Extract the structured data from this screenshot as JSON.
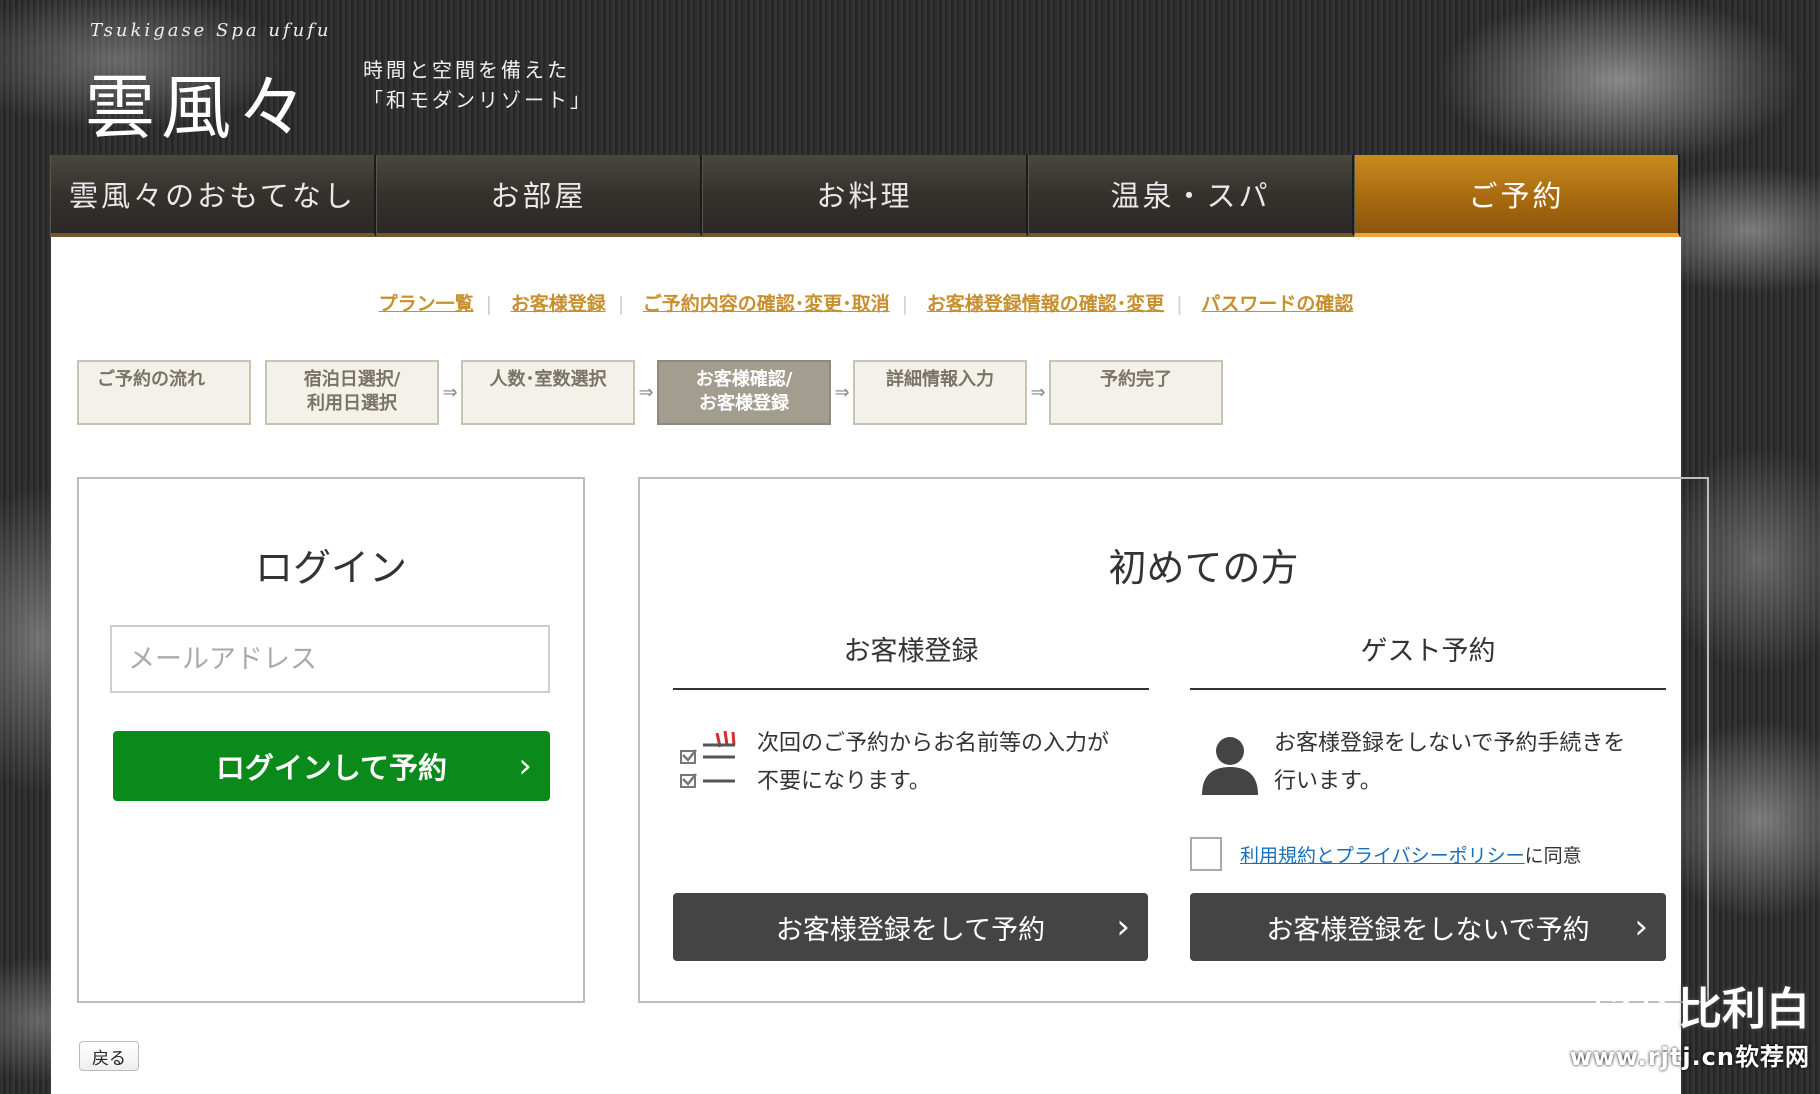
{
  "header": {
    "logo_script": "Tsukigase Spa ufufu",
    "logo_main": "雲風々",
    "tagline_line1": "時間と空間を備えた",
    "tagline_line2": "「和モダンリゾート」"
  },
  "nav": {
    "items": [
      {
        "label": "雲風々のおもてなし"
      },
      {
        "label": "お部屋"
      },
      {
        "label": "お料理"
      },
      {
        "label": "温泉・スパ"
      },
      {
        "label": "ご予約"
      }
    ],
    "active_index": 4
  },
  "top_links": [
    {
      "label": "プラン一覧"
    },
    {
      "label": "お客様登録"
    },
    {
      "label": "ご予約内容の確認･変更･取消"
    },
    {
      "label": "お客様登録情報の確認･変更"
    },
    {
      "label": "パスワードの確認"
    }
  ],
  "steps": [
    {
      "line1": "ご予約の流れ",
      "line2": ""
    },
    {
      "line1": "宿泊日選択/",
      "line2": "利用日選択"
    },
    {
      "line1": "人数･室数選択",
      "line2": ""
    },
    {
      "line1": "お客様確認/",
      "line2": "お客様登録"
    },
    {
      "line1": "詳細情報入力",
      "line2": ""
    },
    {
      "line1": "予約完了",
      "line2": ""
    }
  ],
  "step_arrow": "⇒",
  "current_step_index": 3,
  "login": {
    "title": "ログイン",
    "email_placeholder": "メールアドレス",
    "button_label": "ログインして予約",
    "chevron": "›"
  },
  "first_time": {
    "title": "初めての方",
    "register": {
      "title": "お客様登録",
      "text_line1": "次回のご予約からお名前等の入力が",
      "text_line2": "不要になります。",
      "button_label": "お客様登録をして予約"
    },
    "guest": {
      "title": "ゲスト予約",
      "text_line1": "お客様登録をしないで予約手続きを",
      "text_line2": "行います。",
      "agree_link": "利用規約とプライバシーポリシー",
      "agree_suffix": "に同意",
      "button_label": "お客様登録をしないで予約"
    }
  },
  "back_button": "戻る",
  "watermark": {
    "brand": "比利白",
    "url": "www.rjtj.cn软荐网"
  },
  "colors": {
    "accent_gold": "#c6902f",
    "login_green": "#0a8a1a",
    "dark_button": "#444444",
    "link_blue": "#1a6fb8",
    "active_nav": "#a96a10"
  }
}
